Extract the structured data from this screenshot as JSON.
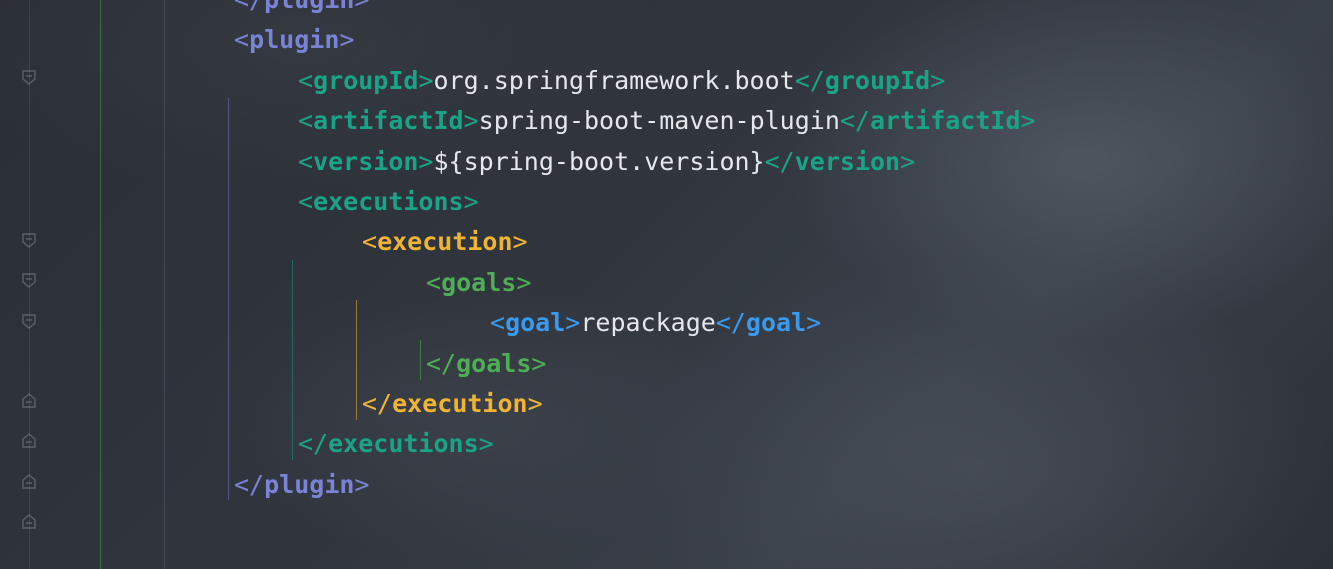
{
  "editor": {
    "lines": [
      {
        "indent": 0,
        "color": "plugin",
        "kind": "close",
        "tag": "plugin",
        "partial": true
      },
      {
        "indent": 0,
        "color": "plugin",
        "kind": "open",
        "tag": "plugin"
      },
      {
        "indent": 1,
        "color": "teal",
        "kind": "element",
        "tag": "groupId",
        "text": "org.springframework.boot"
      },
      {
        "indent": 1,
        "color": "teal",
        "kind": "element",
        "tag": "artifactId",
        "text": "spring-boot-maven-plugin"
      },
      {
        "indent": 1,
        "color": "teal",
        "kind": "element",
        "tag": "version",
        "text": "${spring-boot.version}"
      },
      {
        "indent": 1,
        "color": "teal",
        "kind": "open",
        "tag": "executions"
      },
      {
        "indent": 2,
        "color": "yellow",
        "kind": "open",
        "tag": "execution"
      },
      {
        "indent": 3,
        "color": "green",
        "kind": "open",
        "tag": "goals"
      },
      {
        "indent": 4,
        "color": "blue",
        "kind": "element",
        "tag": "goal",
        "text": "repackage"
      },
      {
        "indent": 3,
        "color": "green",
        "kind": "close",
        "tag": "goals"
      },
      {
        "indent": 2,
        "color": "yellow",
        "kind": "close",
        "tag": "execution"
      },
      {
        "indent": 1,
        "color": "teal",
        "kind": "close",
        "tag": "executions"
      },
      {
        "indent": 0,
        "color": "plugin",
        "kind": "close",
        "tag": "plugin"
      }
    ]
  },
  "colors": {
    "plugin": "#7b83d6",
    "teal": "#19a487",
    "yellow": "#f0b332",
    "green": "#4fae55",
    "blue": "#3a9af0",
    "text": "#e4e7ec"
  }
}
